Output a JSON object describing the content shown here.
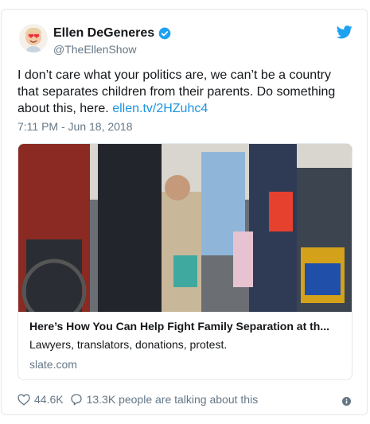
{
  "author": {
    "name": "Ellen DeGeneres",
    "handle": "@TheEllenShow",
    "verified": true
  },
  "tweet": {
    "text": "I don’t care what your politics are, we can’t be a country that separates children from their parents. Do something about this, here. ",
    "link_text": "ellen.tv/2HZuhc4",
    "timestamp": "7:11 PM - Jun 18, 2018"
  },
  "link_card": {
    "title": "Here’s How You Can Help Fight Family Separation at th...",
    "description": "Lawyers, translators, donations, protest.",
    "domain": "slate.com"
  },
  "actions": {
    "likes": "44.6K",
    "talking": "13.3K people are talking about this"
  },
  "colors": {
    "link": "#1b95e0",
    "muted": "#657786",
    "brand": "#1da1f2"
  },
  "icons": [
    "verified-badge-icon",
    "twitter-bird-icon",
    "heart-icon",
    "comment-icon",
    "info-icon"
  ]
}
